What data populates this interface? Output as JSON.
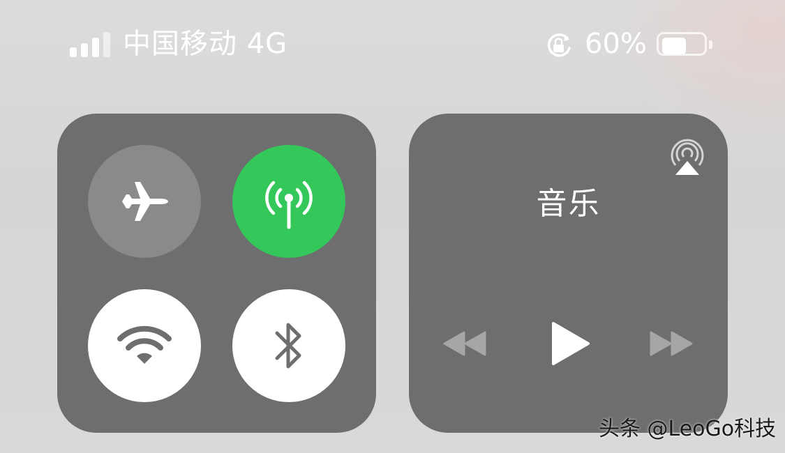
{
  "status_bar": {
    "signal_bars_active": 3,
    "signal_bars_total": 4,
    "carrier": "中国移动 4G",
    "rotation_lock_icon": "rotation-lock-icon",
    "battery_percent_label": "60%",
    "battery_level": 0.6
  },
  "connectivity": {
    "airplane": {
      "icon": "airplane-icon",
      "active": false
    },
    "cellular": {
      "icon": "cellular-antenna-icon",
      "active": true,
      "color": "#34c759"
    },
    "wifi": {
      "icon": "wifi-icon",
      "active": true
    },
    "bluetooth": {
      "icon": "bluetooth-icon",
      "active": true
    }
  },
  "music": {
    "title": "音乐",
    "airplay_icon": "airplay-icon",
    "controls": [
      "rewind-icon",
      "play-icon",
      "fast-forward-icon"
    ]
  },
  "watermark": "头条 @LeoGo科技",
  "colors": {
    "module_bg": "#6e6e70",
    "toggle_on_white": "#ffffff",
    "cellular_green": "#34c759",
    "toggle_off": "#8a8a8c"
  }
}
